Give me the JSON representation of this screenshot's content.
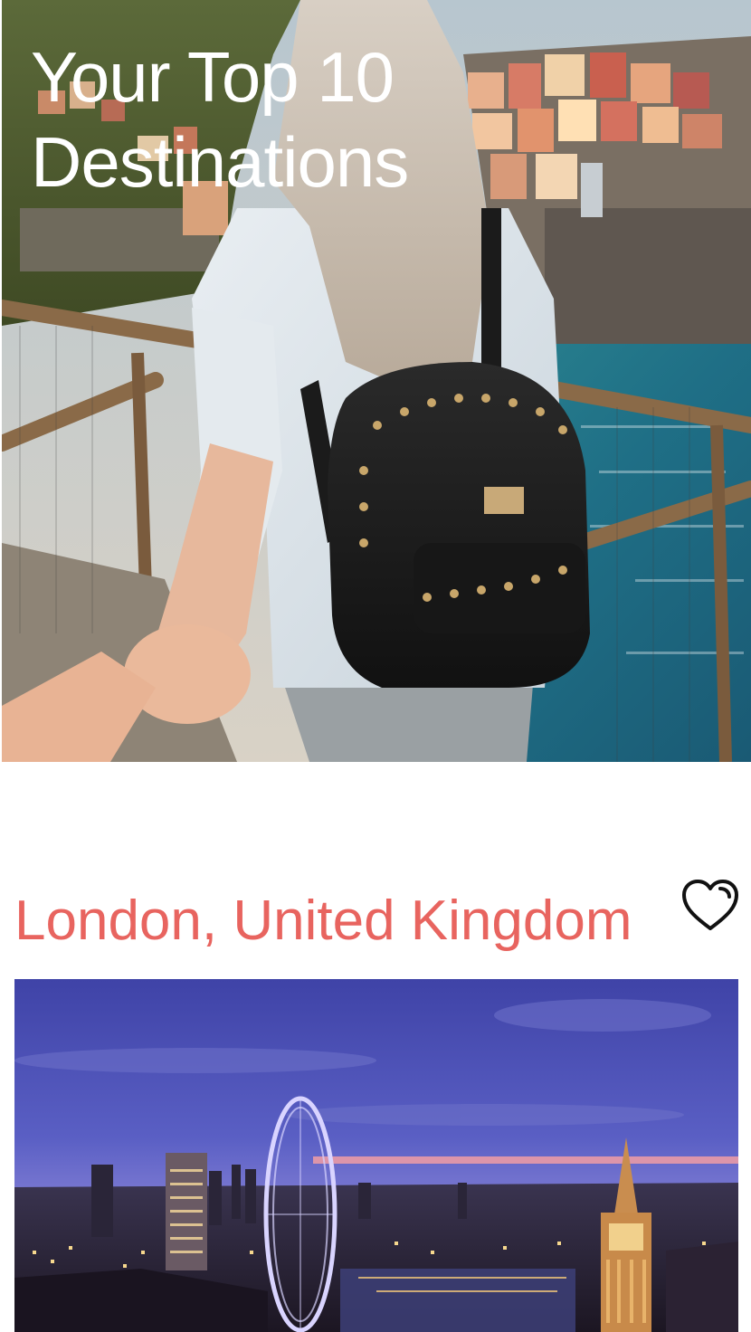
{
  "hero": {
    "title": "Your Top 10 Destinations",
    "image": "woman-with-backpack-leading-by-hand-over-coastal-village"
  },
  "destinations": [
    {
      "name": "London, United Kingdom",
      "favorite_icon": "heart-outline-icon",
      "image": "london-skyline-at-dusk-with-london-eye-and-big-ben"
    }
  ],
  "colors": {
    "destination_title": "#e8645f",
    "hero_title": "#ffffff",
    "background": "#ffffff"
  }
}
